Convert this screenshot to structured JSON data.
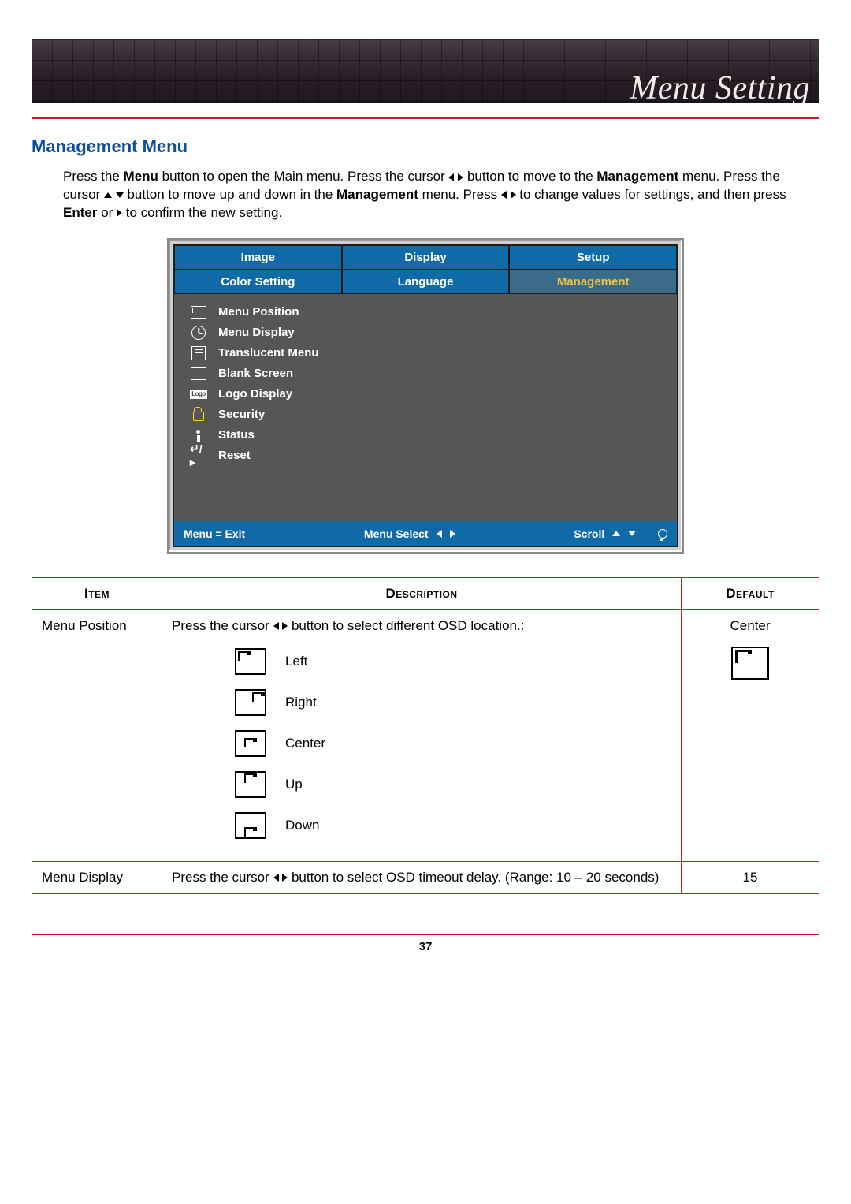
{
  "header": {
    "title": "Menu Setting"
  },
  "section_title": "Management Menu",
  "intro": {
    "t1": "Press the ",
    "b1": "Menu",
    "t2": " button to open the Main menu. Press the cursor ",
    "t3": " button to move to the ",
    "b2": "Management",
    "t4": " menu. Press the cursor ",
    "t5": " button to move up and down in the ",
    "b3": "Management",
    "t6": " menu. Press ",
    "t7": " to change values for settings, and then press ",
    "b4": "Enter",
    "t8": " or ",
    "t9": " to confirm the new setting."
  },
  "osd": {
    "tabs_row1": [
      "Image",
      "Display",
      "Setup"
    ],
    "tabs_row2": [
      "Color Setting",
      "Language",
      "Management"
    ],
    "active_row2_index": 2,
    "items": [
      {
        "icon": "position",
        "label": "Menu Position"
      },
      {
        "icon": "clock",
        "label": "Menu Display"
      },
      {
        "icon": "doc",
        "label": "Translucent Menu"
      },
      {
        "icon": "blank",
        "label": "Blank Screen"
      },
      {
        "icon": "logo",
        "label": "Logo Display"
      },
      {
        "icon": "lock",
        "label": "Security"
      },
      {
        "icon": "info",
        "label": "Status"
      },
      {
        "icon": "reset",
        "label": "Reset"
      }
    ],
    "footer": {
      "exit": "Menu = Exit",
      "select": "Menu Select",
      "scroll": "Scroll"
    }
  },
  "table": {
    "headers": {
      "item": "Item",
      "desc": "Description",
      "def": "Default"
    },
    "rows": [
      {
        "item": "Menu Position",
        "desc_lead": "Press the cursor ",
        "desc_tail": " button to select different OSD location.:",
        "options": [
          "Left",
          "Right",
          "Center",
          "Up",
          "Down"
        ],
        "default": "Center"
      },
      {
        "item": "Menu Display",
        "desc_lead": "Press the cursor ",
        "desc_tail": " button to select OSD timeout delay. (Range: 10 – 20 seconds)",
        "default": "15"
      }
    ]
  },
  "page_number": "37"
}
